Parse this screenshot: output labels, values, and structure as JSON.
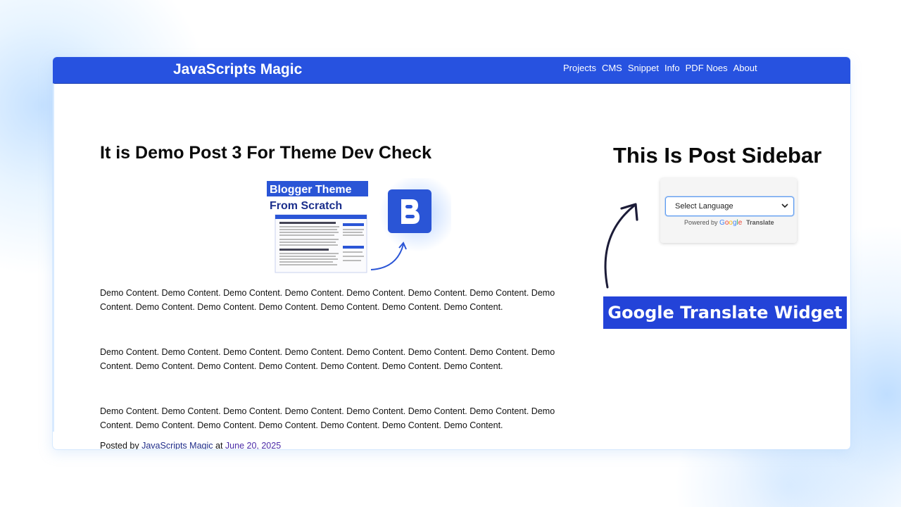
{
  "site": {
    "title": "JavaScripts Magic",
    "nav": [
      "Projects",
      "CMS",
      "Snippet",
      "Info",
      "PDF Noes",
      "About"
    ]
  },
  "post": {
    "title": "It is Demo Post 3 For Theme Dev Check",
    "thumbnail": {
      "heading_line1": "Blogger Theme",
      "heading_line2": "From Scratch",
      "icon": "blogger-logo-icon"
    },
    "paragraphs": [
      "Demo Content. Demo Content. Demo Content. Demo Content. Demo Content. Demo Content. Demo Content. Demo Content. Demo Content. Demo Content. Demo Content. Demo Content. Demo Content. Demo Content.",
      "Demo Content. Demo Content. Demo Content. Demo Content. Demo Content. Demo Content. Demo Content. Demo Content. Demo Content. Demo Content. Demo Content. Demo Content. Demo Content. Demo Content.",
      "Demo Content. Demo Content. Demo Content. Demo Content. Demo Content. Demo Content. Demo Content. Demo Content. Demo Content. Demo Content. Demo Content. Demo Content. Demo Content. Demo Content."
    ],
    "byline": {
      "prefix": "Posted by",
      "author": "JavaScripts Magic",
      "at": "at",
      "date": "June 20, 2025"
    }
  },
  "sidebar": {
    "title": "This Is Post Sidebar",
    "translate": {
      "select_label": "Select Language",
      "powered_by": "Powered by",
      "google": "Google",
      "translate": "Translate"
    },
    "callout": "Google Translate Widget"
  },
  "colors": {
    "navbar": "#2752e0",
    "callout": "#2343d8",
    "link": "#1f2d8a",
    "date_link": "#4b2ca8"
  }
}
